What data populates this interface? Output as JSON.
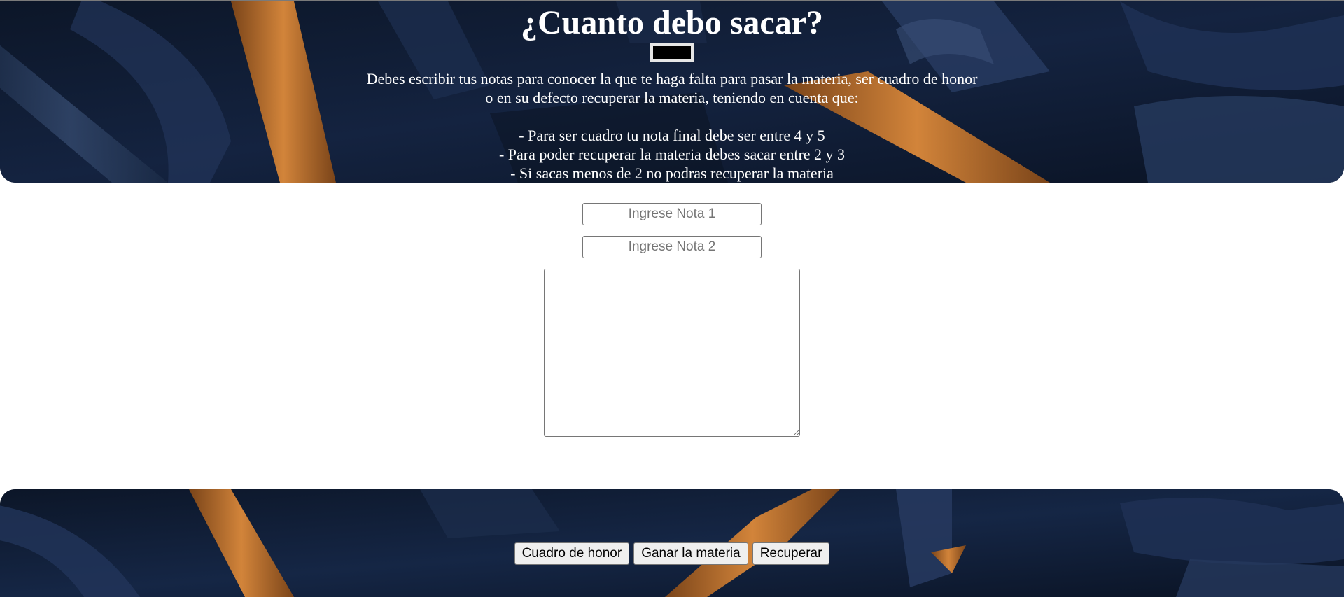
{
  "header": {
    "title": "¿Cuanto debo sacar?",
    "description_line1": "Debes escribir tus notas para conocer la que te haga falta para pasar la materia, ser cuadro de honor",
    "description_line2": "o en su defecto recuperar la materia, teniendo en cuenta que:",
    "rules": [
      "- Para ser cuadro tu nota final debe ser entre 4 y 5",
      "- Para poder recuperar la materia debes sacar entre 2 y 3",
      "- Si sacas menos de 2 no podras recuperar la materia"
    ]
  },
  "form": {
    "nota1_placeholder": "Ingrese Nota 1",
    "nota1_value": "",
    "nota2_placeholder": "Ingrese Nota 2",
    "nota2_value": "",
    "result_value": ""
  },
  "footer": {
    "buttons": [
      "Cuadro de honor",
      "Ganar la materia",
      "Recuperar"
    ]
  },
  "colors": {
    "panel_dark": "#0d1729",
    "beam_orange": "#c8782c",
    "beam_blue": "#2e3f5c"
  }
}
